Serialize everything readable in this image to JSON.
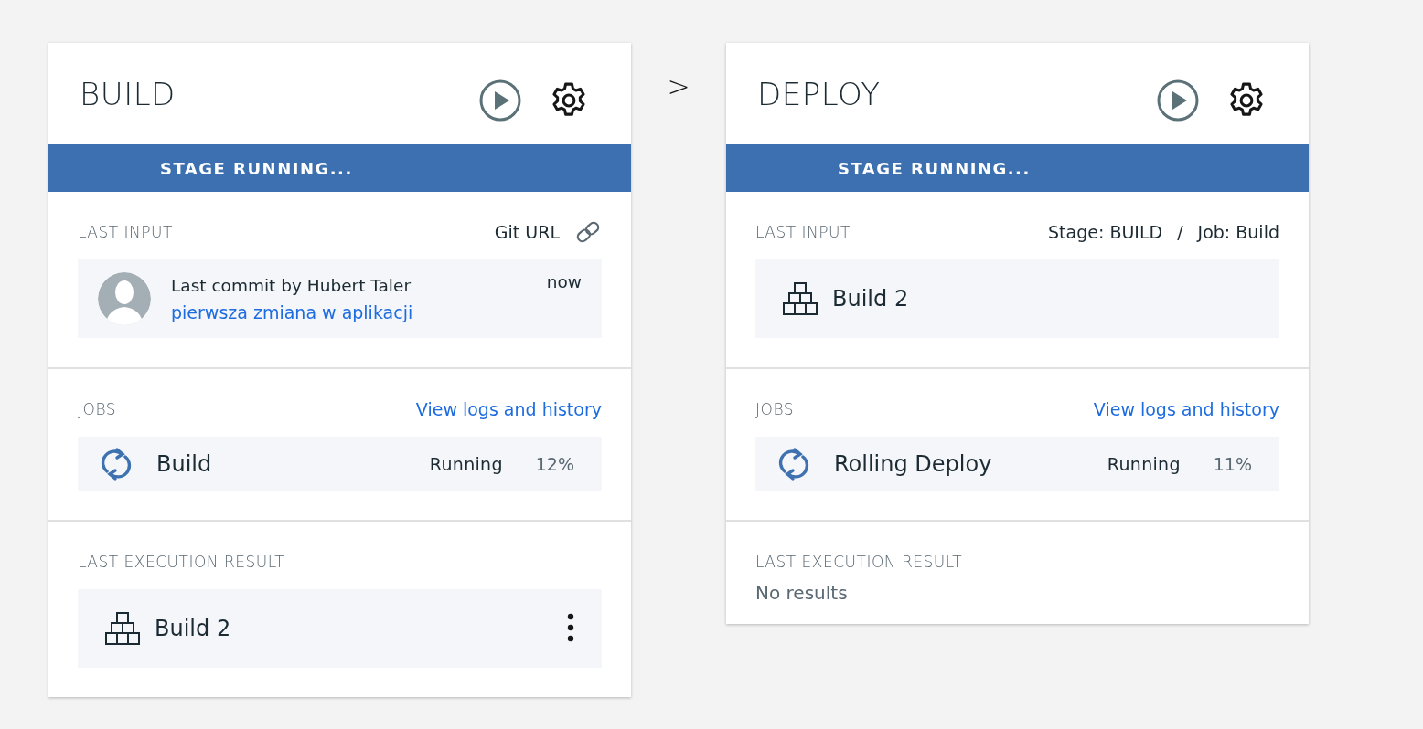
{
  "stages": [
    {
      "title": "BUILD",
      "banner": "STAGE RUNNING...",
      "last_input": {
        "label": "LAST INPUT",
        "source": {
          "kind": "link",
          "parts": [
            "Git URL"
          ]
        },
        "item": {
          "kind": "commit",
          "text": "Last commit by Hubert Taler",
          "message": "pierwsza zmiana w aplikacji",
          "time": "now"
        }
      },
      "jobs": {
        "label": "JOBS",
        "link": "View logs and history",
        "items": [
          {
            "name": "Build",
            "status": "Running",
            "percent": "12%"
          }
        ]
      },
      "result": {
        "label": "LAST EXECUTION RESULT",
        "kind": "build",
        "text": "Build 2"
      }
    },
    {
      "title": "DEPLOY",
      "banner": "STAGE RUNNING...",
      "last_input": {
        "label": "LAST INPUT",
        "source": {
          "kind": "path",
          "parts": [
            "Stage: BUILD",
            "/",
            "Job: Build"
          ]
        },
        "item": {
          "kind": "build",
          "text": "Build 2"
        }
      },
      "jobs": {
        "label": "JOBS",
        "link": "View logs and history",
        "items": [
          {
            "name": "Rolling Deploy",
            "status": "Running",
            "percent": "11%"
          }
        ]
      },
      "result": {
        "label": "LAST EXECUTION RESULT",
        "kind": "empty",
        "text": "No results"
      }
    }
  ],
  "connector": ">"
}
